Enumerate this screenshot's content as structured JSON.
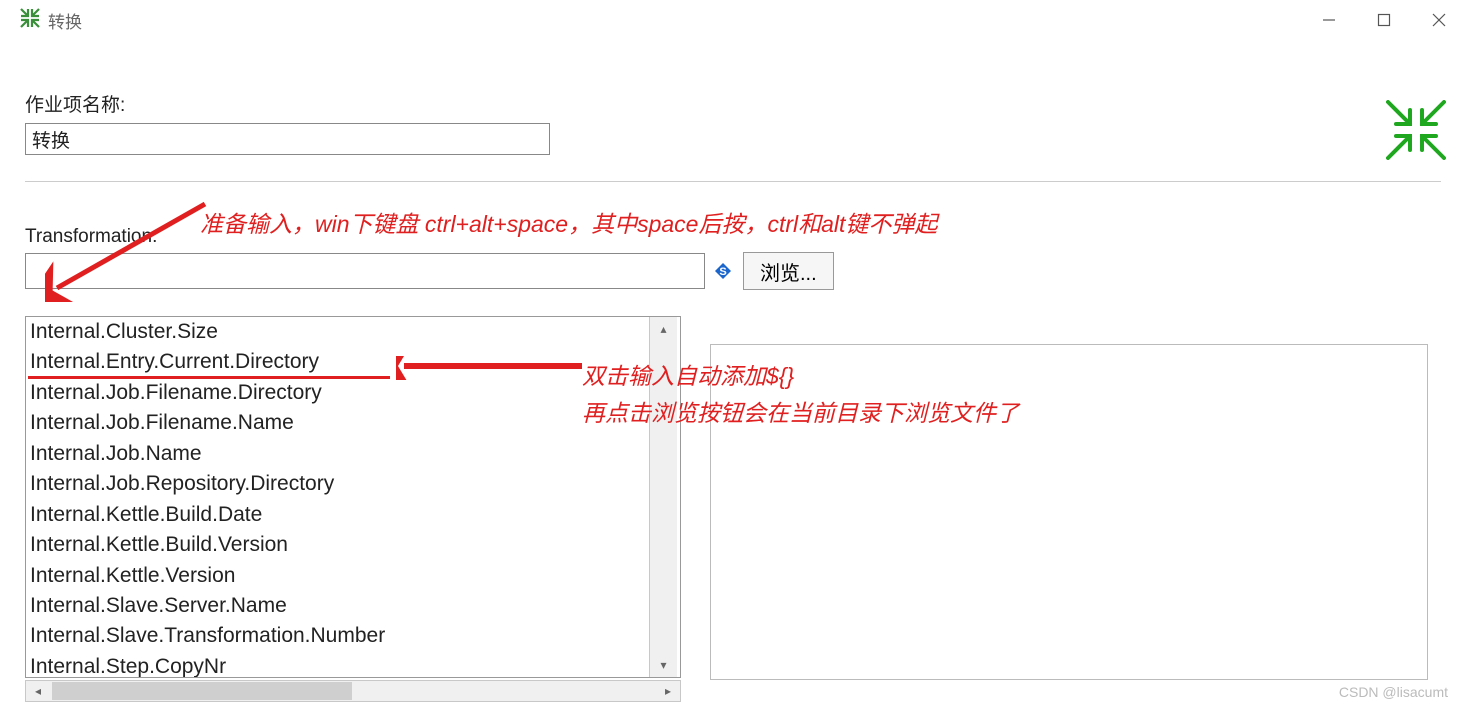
{
  "window": {
    "title": "转换"
  },
  "field1": {
    "label": "作业项名称:",
    "value": "转换"
  },
  "annotation_top": "准备输入，win下键盘 ctrl+alt+space，其中space后按，ctrl和alt键不弹起",
  "transformation": {
    "label": "Transformation:",
    "value": "",
    "browse_label": "浏览..."
  },
  "dropdown": {
    "items": [
      "Internal.Cluster.Size",
      "Internal.Entry.Current.Directory",
      "Internal.Job.Filename.Directory",
      "Internal.Job.Filename.Name",
      "Internal.Job.Name",
      "Internal.Job.Repository.Directory",
      "Internal.Kettle.Build.Date",
      "Internal.Kettle.Build.Version",
      "Internal.Kettle.Version",
      "Internal.Slave.Server.Name",
      "Internal.Slave.Transformation.Number",
      "Internal.Step.CopyNr"
    ]
  },
  "annotation_mid_line1": "双击输入自动添加${}",
  "annotation_mid_line2": "再点击浏览按钮会在当前目录下浏览文件了",
  "watermark": "CSDN @lisacumt"
}
